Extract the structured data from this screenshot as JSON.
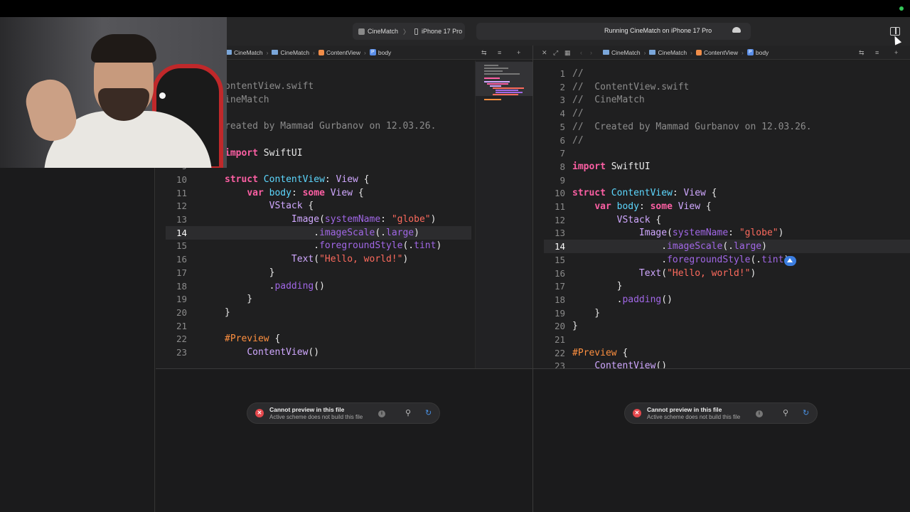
{
  "toolbar": {
    "scheme_app": "CineMatch",
    "scheme_sep": "〉",
    "scheme_device": "iPhone 17 Pro",
    "activity_text": "Running CineMatch on iPhone 17 Pro"
  },
  "left_pane": {
    "jumpbar": [
      "CineMatch",
      "CineMatch",
      "ContentView",
      "body"
    ],
    "lines": [
      {
        "n": "",
        "t": [
          [
            "cm",
            "ontentView.swift"
          ]
        ]
      },
      {
        "n": "",
        "t": [
          [
            "cm",
            "ineMatch"
          ]
        ]
      },
      {
        "n": "",
        "t": [
          [
            "cm",
            ""
          ]
        ]
      },
      {
        "n": "",
        "t": [
          [
            "cm",
            "reated by Mammad Gurbanov on 12.03.26."
          ]
        ]
      },
      {
        "n": "",
        "t": [
          [
            "cm",
            ""
          ]
        ]
      },
      {
        "n": "",
        "t": [
          [
            "kw",
            "import"
          ],
          [
            "pl",
            " SwiftUI"
          ]
        ]
      },
      {
        "n": "9",
        "t": [
          [
            "pl",
            ""
          ]
        ]
      },
      {
        "n": "10",
        "t": [
          [
            "kw",
            "struct"
          ],
          [
            "pl",
            " "
          ],
          [
            "tyd",
            "ContentView"
          ],
          [
            "pl",
            ": "
          ],
          [
            "ty",
            "View"
          ],
          [
            "pl",
            " {"
          ]
        ]
      },
      {
        "n": "11",
        "t": [
          [
            "pl",
            "    "
          ],
          [
            "kw",
            "var"
          ],
          [
            "pl",
            " "
          ],
          [
            "tyd",
            "body"
          ],
          [
            "pl",
            ": "
          ],
          [
            "kw",
            "some"
          ],
          [
            "pl",
            " "
          ],
          [
            "ty",
            "View"
          ],
          [
            "pl",
            " {"
          ]
        ]
      },
      {
        "n": "12",
        "t": [
          [
            "pl",
            "        "
          ],
          [
            "ty",
            "VStack"
          ],
          [
            "pl",
            " {"
          ]
        ]
      },
      {
        "n": "13",
        "t": [
          [
            "pl",
            "            "
          ],
          [
            "ty",
            "Image"
          ],
          [
            "pl",
            "("
          ],
          [
            "mth",
            "systemName"
          ],
          [
            "pl",
            ": "
          ],
          [
            "str",
            "\"globe\""
          ],
          [
            "pl",
            ")"
          ]
        ]
      },
      {
        "n": "14",
        "t": [
          [
            "pl",
            "                ."
          ],
          [
            "mth",
            "imageScale"
          ],
          [
            "pl",
            "(."
          ],
          [
            "mth",
            "large"
          ],
          [
            "pl",
            ")"
          ]
        ]
      },
      {
        "n": "15",
        "t": [
          [
            "pl",
            "                ."
          ],
          [
            "mth",
            "foregroundStyle"
          ],
          [
            "pl",
            "(."
          ],
          [
            "mth",
            "tint"
          ],
          [
            "pl",
            ")"
          ]
        ]
      },
      {
        "n": "16",
        "t": [
          [
            "pl",
            "            "
          ],
          [
            "ty",
            "Text"
          ],
          [
            "pl",
            "("
          ],
          [
            "str",
            "\"Hello, world!\""
          ],
          [
            "pl",
            ")"
          ]
        ]
      },
      {
        "n": "17",
        "t": [
          [
            "pl",
            "        }"
          ]
        ]
      },
      {
        "n": "18",
        "t": [
          [
            "pl",
            "        ."
          ],
          [
            "mth",
            "padding"
          ],
          [
            "pl",
            "()"
          ]
        ]
      },
      {
        "n": "19",
        "t": [
          [
            "pl",
            "    }"
          ]
        ]
      },
      {
        "n": "20",
        "t": [
          [
            "pl",
            "}"
          ]
        ]
      },
      {
        "n": "21",
        "t": [
          [
            "pl",
            ""
          ]
        ]
      },
      {
        "n": "22",
        "t": [
          [
            "dir",
            "#Preview"
          ],
          [
            "pl",
            " {"
          ]
        ]
      },
      {
        "n": "23",
        "t": [
          [
            "pl",
            "    "
          ],
          [
            "ty",
            "ContentView"
          ],
          [
            "pl",
            "()"
          ]
        ]
      }
    ],
    "notice_title": "Cannot preview in this file",
    "notice_sub": "Active scheme does not build this file"
  },
  "right_pane": {
    "jumpbar": [
      "CineMatch",
      "CineMatch",
      "ContentView",
      "body"
    ],
    "lines": [
      {
        "n": "1",
        "t": [
          [
            "cm",
            "//"
          ]
        ]
      },
      {
        "n": "2",
        "t": [
          [
            "cm",
            "//  ContentView.swift"
          ]
        ]
      },
      {
        "n": "3",
        "t": [
          [
            "cm",
            "//  CineMatch"
          ]
        ]
      },
      {
        "n": "4",
        "t": [
          [
            "cm",
            "//"
          ]
        ]
      },
      {
        "n": "5",
        "t": [
          [
            "cm",
            "//  Created by Mammad Gurbanov on 12.03.26."
          ]
        ]
      },
      {
        "n": "6",
        "t": [
          [
            "cm",
            "//"
          ]
        ]
      },
      {
        "n": "7",
        "t": [
          [
            "pl",
            ""
          ]
        ]
      },
      {
        "n": "8",
        "t": [
          [
            "kw",
            "import"
          ],
          [
            "pl",
            " SwiftUI"
          ]
        ]
      },
      {
        "n": "9",
        "t": [
          [
            "pl",
            ""
          ]
        ]
      },
      {
        "n": "10",
        "t": [
          [
            "kw",
            "struct"
          ],
          [
            "pl",
            " "
          ],
          [
            "tyd",
            "ContentView"
          ],
          [
            "pl",
            ": "
          ],
          [
            "ty",
            "View"
          ],
          [
            "pl",
            " {"
          ]
        ]
      },
      {
        "n": "11",
        "t": [
          [
            "pl",
            "    "
          ],
          [
            "kw",
            "var"
          ],
          [
            "pl",
            " "
          ],
          [
            "tyd",
            "body"
          ],
          [
            "pl",
            ": "
          ],
          [
            "kw",
            "some"
          ],
          [
            "pl",
            " "
          ],
          [
            "ty",
            "View"
          ],
          [
            "pl",
            " {"
          ]
        ]
      },
      {
        "n": "12",
        "t": [
          [
            "pl",
            "        "
          ],
          [
            "ty",
            "VStack"
          ],
          [
            "pl",
            " {"
          ]
        ]
      },
      {
        "n": "13",
        "t": [
          [
            "pl",
            "            "
          ],
          [
            "ty",
            "Image"
          ],
          [
            "pl",
            "("
          ],
          [
            "mth",
            "systemName"
          ],
          [
            "pl",
            ": "
          ],
          [
            "str",
            "\"globe\""
          ],
          [
            "pl",
            ")"
          ]
        ]
      },
      {
        "n": "14",
        "t": [
          [
            "pl",
            "                ."
          ],
          [
            "mth",
            "imageScale"
          ],
          [
            "pl",
            "(."
          ],
          [
            "mth",
            "large"
          ],
          [
            "pl",
            ")"
          ]
        ]
      },
      {
        "n": "15",
        "t": [
          [
            "pl",
            "                ."
          ],
          [
            "mth",
            "foregroundStyle"
          ],
          [
            "pl",
            "(."
          ],
          [
            "mth",
            "tint"
          ],
          [
            "pl",
            ")"
          ]
        ]
      },
      {
        "n": "16",
        "t": [
          [
            "pl",
            "            "
          ],
          [
            "ty",
            "Text"
          ],
          [
            "pl",
            "("
          ],
          [
            "str",
            "\"Hello, world!\""
          ],
          [
            "pl",
            ")"
          ]
        ]
      },
      {
        "n": "17",
        "t": [
          [
            "pl",
            "        }"
          ]
        ]
      },
      {
        "n": "18",
        "t": [
          [
            "pl",
            "        ."
          ],
          [
            "mth",
            "padding"
          ],
          [
            "pl",
            "()"
          ]
        ]
      },
      {
        "n": "19",
        "t": [
          [
            "pl",
            "    }"
          ]
        ]
      },
      {
        "n": "20",
        "t": [
          [
            "pl",
            "}"
          ]
        ]
      },
      {
        "n": "21",
        "t": [
          [
            "pl",
            ""
          ]
        ]
      },
      {
        "n": "22",
        "t": [
          [
            "dir",
            "#Preview"
          ],
          [
            "pl",
            " {"
          ]
        ]
      },
      {
        "n": "23",
        "t": [
          [
            "pl",
            "    "
          ],
          [
            "ty",
            "ContentView"
          ],
          [
            "pl",
            "()"
          ]
        ]
      }
    ],
    "notice_title": "Cannot preview in this file",
    "notice_sub": "Active scheme does not build this file"
  },
  "active_line": "14",
  "icons": {
    "notice_error": "error-icon",
    "notice_info": "info-icon",
    "notice_pin": "pin-icon",
    "notice_refresh": "refresh-icon",
    "inspector_toggle": "inspector-icon"
  },
  "colors": {
    "keyword": "#fc5fa3",
    "type": "#d0a8ff",
    "string": "#fc6a5d",
    "method": "#a167e6",
    "comment": "#8c8c8c",
    "accent": "#3b7de0",
    "error": "#e5484d"
  }
}
